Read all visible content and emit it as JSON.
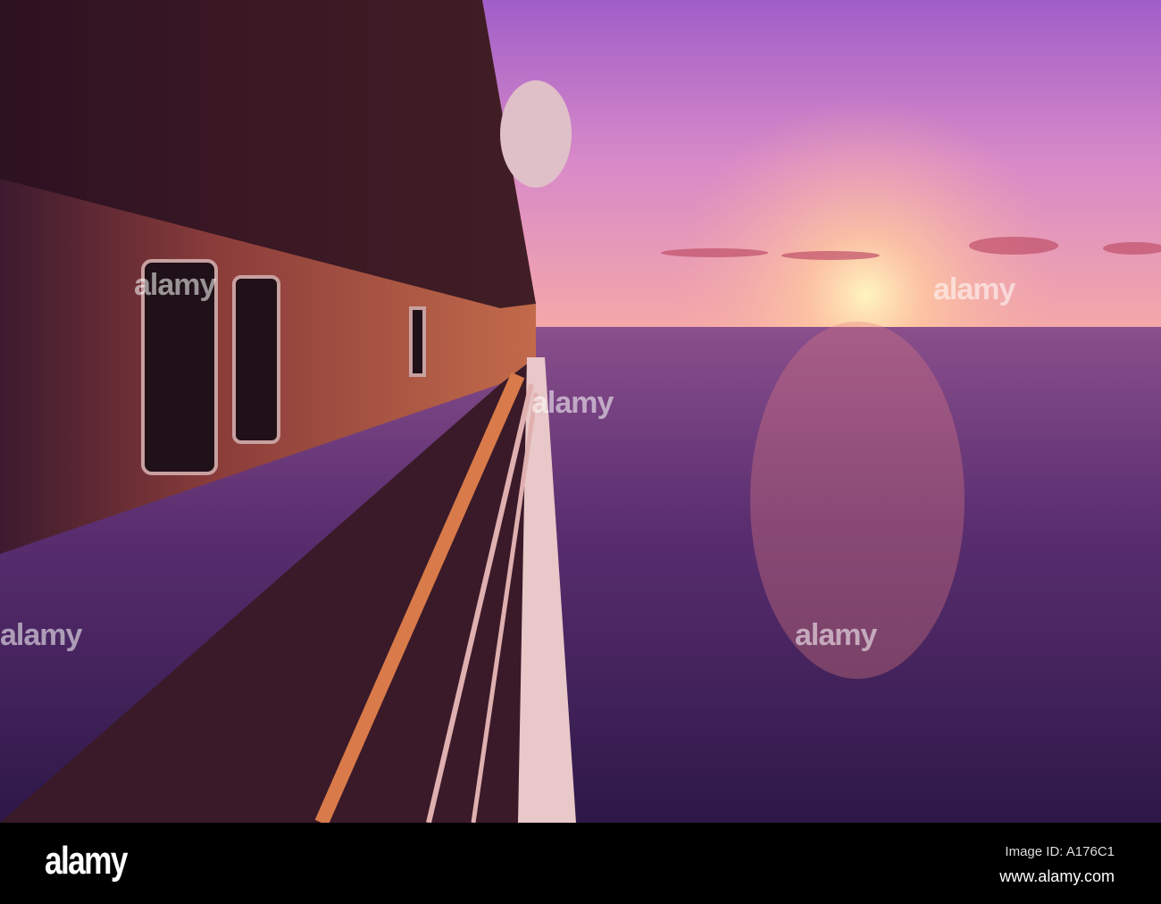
{
  "watermark": {
    "text": "alamy"
  },
  "footer": {
    "logo": "alamy",
    "image_id": "Image ID: A176C1",
    "website": "www.alamy.com"
  },
  "colors": {
    "sky_top": "#a05ec8",
    "sky_horizon": "#f6a7a0",
    "sun": "#fff0b0",
    "sea": "#3a1e5a",
    "hull": "#5a2a40"
  }
}
